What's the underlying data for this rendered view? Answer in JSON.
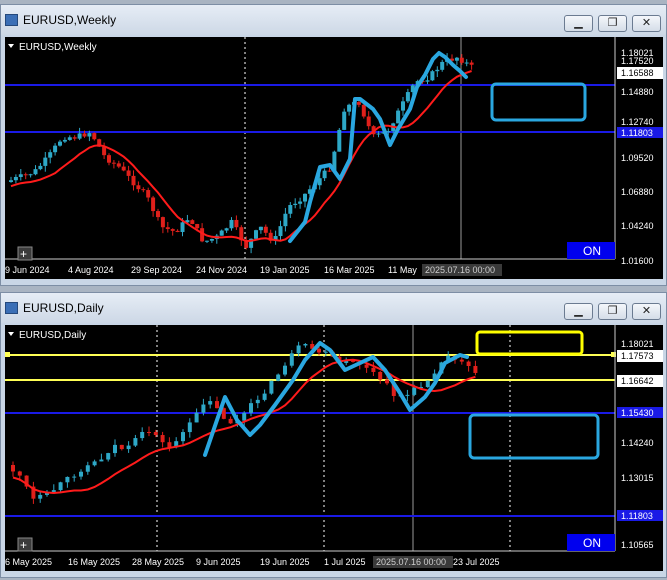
{
  "weekly": {
    "window_title": "EURUSD,Weekly",
    "chart_label": "EURUSD,Weekly",
    "price_labels": [
      "1.18021",
      "1.17520",
      "1.16588",
      "1.14880",
      "1.12740",
      "1.11803",
      "1.09520",
      "1.06880",
      "1.04240",
      "1.01600"
    ],
    "date_labels": [
      "9 Jun 2024",
      "4 Aug 2024",
      "29 Sep 2024",
      "24 Nov 2024",
      "19 Jan 2025",
      "16 Mar 2025",
      "11 May",
      "2025.07.16 00:00"
    ],
    "on_label": "ON",
    "button_labels": {
      "minimize": "▁",
      "restore": "❐",
      "close": "✕"
    }
  },
  "daily": {
    "window_title": "EURUSD,Daily",
    "chart_label": "EURUSD,Daily",
    "price_labels": [
      "1.18021",
      "1.17573",
      "1.16642",
      "1.15430",
      "1.14240",
      "1.13015",
      "1.11803",
      "1.10565"
    ],
    "date_labels": [
      "6 May 2025",
      "16 May 2025",
      "28 May 2025",
      "9 Jun 2025",
      "19 Jun 2025",
      "1 Jul 2025",
      "2025.07.16 00:00",
      "23 Jul 2025"
    ],
    "on_label": "ON",
    "button_labels": {
      "minimize": "▁",
      "restore": "❐",
      "close": "✕"
    }
  },
  "colors": {
    "background": "#000000",
    "bull": "#2ea8c7",
    "bear": "#e0201b",
    "ma": "#ff1b1b",
    "blue_line": "#1a1ae6",
    "yellow_line": "#ffff55",
    "annotation": "#2aa7e0",
    "on_badge": "#0000ee"
  }
}
